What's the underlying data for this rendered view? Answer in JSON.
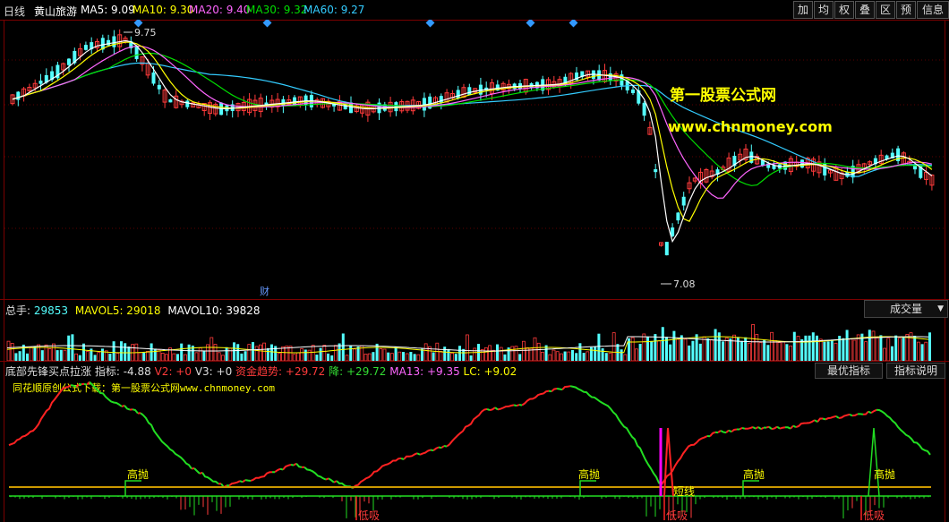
{
  "header": {
    "period": "日线",
    "stock_name": "黄山旅游",
    "ma5": "MA5: 9.09",
    "ma10": "MA10: 9.30",
    "ma20": "MA20: 9.40",
    "ma30": "MA30: 9.32",
    "ma60": "MA60: 9.27",
    "buttons": [
      "加",
      "均",
      "权",
      "叠",
      "区",
      "预",
      "信息"
    ]
  },
  "price_panel": {
    "high_label": "9.75",
    "low_label": "7.08",
    "finance_marker": "财",
    "watermark_cn": "第一股票公式网",
    "watermark_url": "www.chnmoney.com"
  },
  "volume_panel": {
    "total_label": "总手:",
    "total_value": "29853",
    "mavol5": "MAVOL5: 29018",
    "mavol10": "MAVOL10: 39828",
    "dropdown": "成交量"
  },
  "indicator_panel": {
    "name": "底部先锋买点拉涨",
    "zhibiao": "指标: -4.88",
    "v2": "V2: +0",
    "v3": "V3: +0",
    "zijin": "资金趋势: +29.72",
    "jiang": "降: +29.72",
    "ma13": "MA13: +9.35",
    "lc": "LC: +9.02",
    "btn_best": "最优指标",
    "btn_help": "指标说明",
    "source_note": "同花顺原创公式下载：第一股票公式网www.chnmoney.com",
    "signal_high": "高抛",
    "signal_low": "低吸",
    "signal_short": "短线"
  },
  "colors": {
    "up": "#ff3b3b",
    "down": "#54ffff",
    "ma5": "#ffffff",
    "ma10": "#ffff00",
    "ma20": "#ff66ff",
    "ma30": "#00dd00",
    "ma60": "#33ccff",
    "grid": "#7a0000"
  }
}
